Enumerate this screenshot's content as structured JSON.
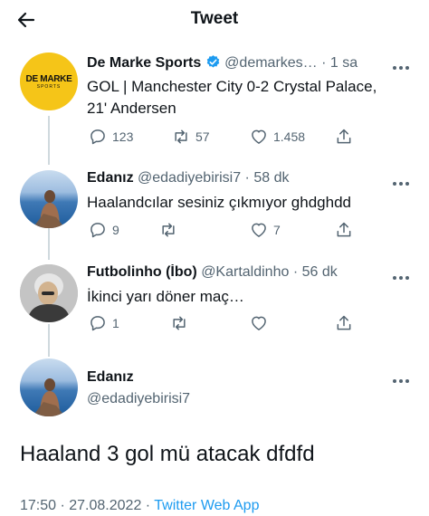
{
  "header": {
    "title": "Tweet"
  },
  "tweets": [
    {
      "name": "De Marke Sports",
      "handle": "@demarkes…",
      "sep": "·",
      "time": "1 sa",
      "text_line1": "GOL | Manchester City 0-2 Crystal Palace,",
      "text_line2": "21' Andersen",
      "replies": "123",
      "retweets": "57",
      "likes": "1.458",
      "avatar_text": "DE MARKE",
      "avatar_sub": "SPORTS"
    },
    {
      "name": "Edanız",
      "handle": "@edadiyebirisi7",
      "sep": "·",
      "time": "58 dk",
      "text": "Haalandcılar sesiniz çıkmıyor ghdghdd",
      "replies": "9",
      "likes": "7"
    },
    {
      "name": "Futbolinho (İbo)",
      "handle": "@Kartaldinho",
      "sep": "·",
      "time": "56 dk",
      "text": "İkinci yarı döner maç…",
      "replies": "1"
    },
    {
      "name": "Edanız",
      "handle": "@edadiyebirisi7"
    }
  ],
  "main": {
    "text": "Haaland 3 gol mü atacak dfdfd",
    "timestamp": "17:50 · 27.08.2022 · ",
    "client": "Twitter Web App"
  },
  "colors": {
    "accent": "#1d9bf0",
    "verified": "#1d9bf0",
    "muted": "#536471",
    "brand_yellow": "#f5c518"
  },
  "icons": [
    "back-arrow-icon",
    "verified-badge-icon",
    "more-icon",
    "reply-icon",
    "retweet-icon",
    "like-icon",
    "share-icon"
  ]
}
